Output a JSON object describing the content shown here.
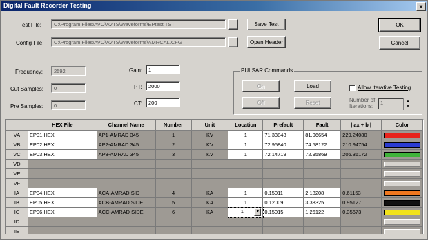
{
  "window": {
    "title": "Digital Fault Recorder Testing",
    "close": "x"
  },
  "files": {
    "test_label": "Test File:",
    "test_path": "C:\\Program Files\\AVO\\AVTS\\Waveforms\\EPtest.TST",
    "config_label": "Config File:",
    "config_path": "C:\\Program Files\\AVO\\AVTS\\Waveforms\\AMRCAL.CFG",
    "browse_label": "..."
  },
  "buttons": {
    "save_test": "Save Test",
    "open_header": "Open Header",
    "ok": "OK",
    "cancel": "Cancel"
  },
  "params": {
    "frequency_label": "Frequency:",
    "frequency": "2592",
    "cut_samples_label": "Cut Samples:",
    "cut_samples": "0",
    "pre_samples_label": "Pre Samples:",
    "pre_samples": "0",
    "gain_label": "Gain:",
    "gain": "1",
    "pt_label": "PT:",
    "pt": "2000",
    "ct_label": "CT:",
    "ct": "200"
  },
  "pulsar": {
    "title": "PULSAR Commands",
    "on": "On",
    "load": "Load",
    "off": "Off",
    "reset": "Reset",
    "allow_label": "Allow Iterative Testing",
    "allow_checked": false,
    "iterations_label_1": "Number of",
    "iterations_label_2": "Iterations:",
    "iterations": "1"
  },
  "table": {
    "headers": [
      "",
      "HEX File",
      "Channel Name",
      "Number",
      "Unit",
      "Location",
      "Prefault",
      "Fault",
      "| ax + b |",
      "Color"
    ],
    "rows": [
      {
        "id": "VA",
        "hex": "EP01.HEX",
        "channel": "AP1-AMRAD 345",
        "number": "1",
        "unit": "KV",
        "location": "1",
        "prefault": "71.33848",
        "fault": "81.06654",
        "axb": "229.24080",
        "color": "#e8231c"
      },
      {
        "id": "VB",
        "hex": "EP02.HEX",
        "channel": "AP2-AMRAD 345",
        "number": "2",
        "unit": "KV",
        "location": "1",
        "prefault": "72.95840",
        "fault": "74.58122",
        "axb": "210.94754",
        "color": "#2a3bd0"
      },
      {
        "id": "VC",
        "hex": "EP03.HEX",
        "channel": "AP3-AMRAD 345",
        "number": "3",
        "unit": "KV",
        "location": "1",
        "prefault": "72.14719",
        "fault": "72.95869",
        "axb": "206.36172",
        "color": "#3fb23a"
      },
      {
        "id": "VD",
        "hex": "",
        "channel": "",
        "number": "",
        "unit": "",
        "location": "",
        "prefault": "",
        "fault": "",
        "axb": "",
        "color": ""
      },
      {
        "id": "VE",
        "hex": "",
        "channel": "",
        "number": "",
        "unit": "",
        "location": "",
        "prefault": "",
        "fault": "",
        "axb": "",
        "color": ""
      },
      {
        "id": "VF",
        "hex": "",
        "channel": "",
        "number": "",
        "unit": "",
        "location": "",
        "prefault": "",
        "fault": "",
        "axb": "",
        "color": ""
      },
      {
        "id": "IA",
        "hex": "EP04.HEX",
        "channel": "ACA-AMRAD SID",
        "number": "4",
        "unit": "KA",
        "location": "1",
        "prefault": "0.15011",
        "fault": "2.18208",
        "axb": "0.61153",
        "color": "#f07820"
      },
      {
        "id": "IB",
        "hex": "EP05.HEX",
        "channel": "ACB-AMRAD SIDE",
        "number": "5",
        "unit": "KA",
        "location": "1",
        "prefault": "0.12009",
        "fault": "3.38325",
        "axb": "0.95127",
        "color": "#111111"
      },
      {
        "id": "IC",
        "hex": "EP06.HEX",
        "channel": "ACC-AMRAD SIDE",
        "number": "6",
        "unit": "KA",
        "location": "1",
        "prefault": "0.15015",
        "fault": "1.26122",
        "axb": "0.35673",
        "color": "#f2e21a"
      },
      {
        "id": "ID",
        "hex": "",
        "channel": "",
        "number": "",
        "unit": "",
        "location": "",
        "prefault": "",
        "fault": "",
        "axb": "",
        "color": ""
      },
      {
        "id": "IE",
        "hex": "",
        "channel": "",
        "number": "",
        "unit": "",
        "location": "",
        "prefault": "",
        "fault": "",
        "axb": "",
        "color": ""
      },
      {
        "id": "IF",
        "hex": "",
        "channel": "",
        "number": "",
        "unit": "",
        "location": "",
        "prefault": "",
        "fault": "",
        "axb": "",
        "color": ""
      }
    ]
  }
}
